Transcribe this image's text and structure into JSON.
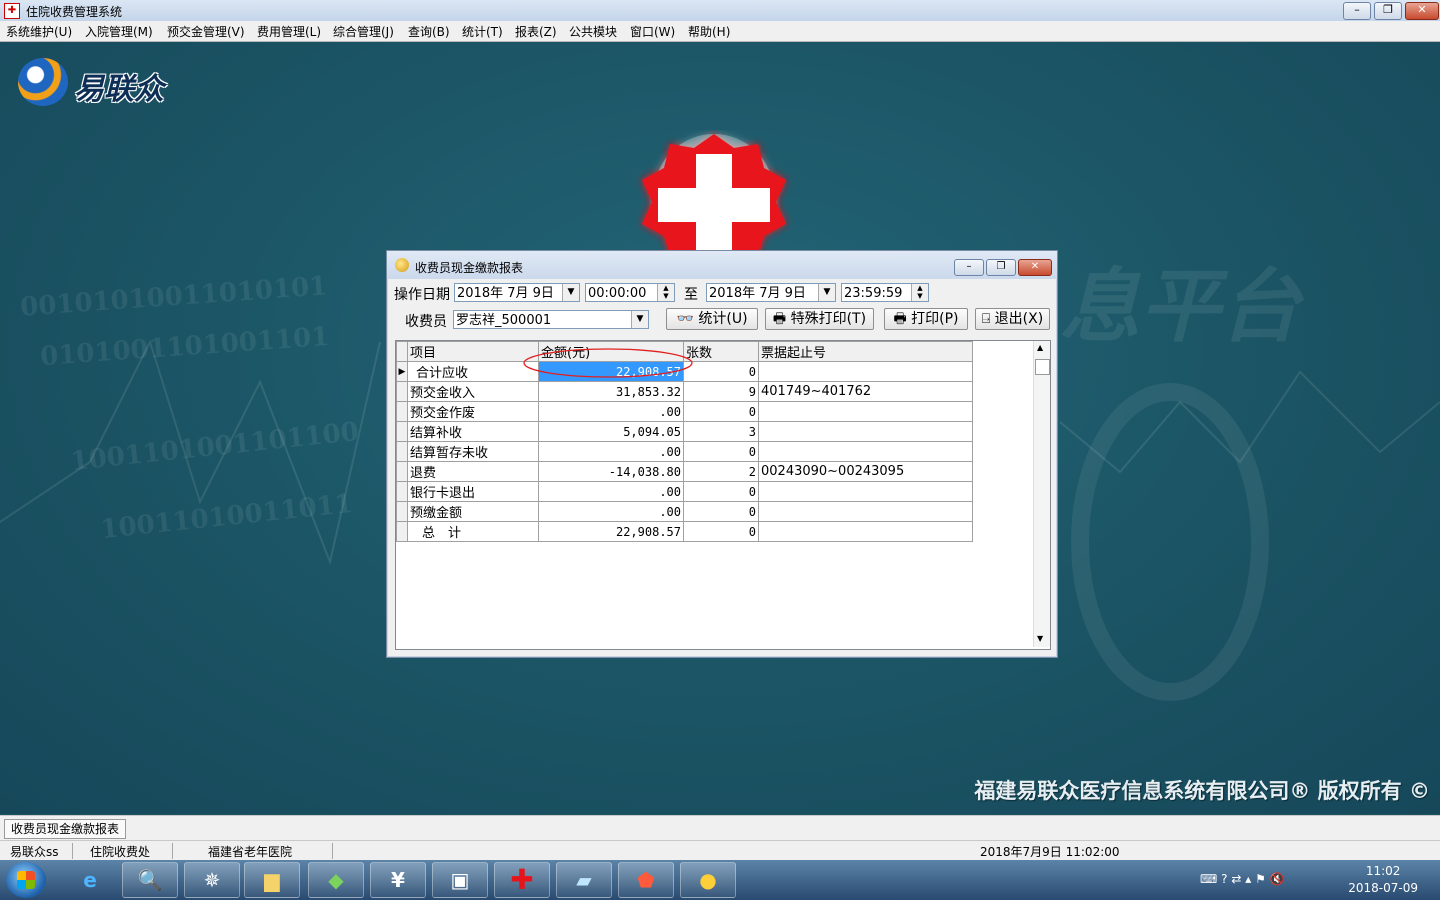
{
  "window": {
    "title": "住院收费管理系统"
  },
  "menu": [
    "系统维护(U)",
    "入院管理(M)",
    "预交金管理(V)",
    "费用管理(L)",
    "综合管理(J)",
    "查询(B)",
    "统计(T)",
    "报表(Z)",
    "公共模块",
    "窗口(W)",
    "帮助(H)"
  ],
  "logo": {
    "text": "易联众"
  },
  "copyright": "福建易联众医疗信息系统有限公司® 版权所有 ©",
  "dialog": {
    "title": "收费员现金缴款报表",
    "op_date_label": "操作日期",
    "start_date": "2018年 7月 9日",
    "start_time": "00:00:00",
    "to_label": "至",
    "end_date": "2018年 7月 9日",
    "end_time": "23:59:59",
    "cashier_label": "收费员",
    "cashier_value": "罗志祥_500001",
    "btn_stat": "统计(U)",
    "btn_special_print": "特殊打印(T)",
    "btn_print": "打印(P)",
    "btn_exit": "退出(X)",
    "grid": {
      "headers": [
        "项目",
        "金额(元)",
        "张数",
        "票据起止号"
      ],
      "rows": [
        {
          "item": "合计应收",
          "amount": "22,908.57",
          "count": "0",
          "range": ""
        },
        {
          "item": "预交金收入",
          "amount": "31,853.32",
          "count": "9",
          "range": "401749~401762"
        },
        {
          "item": "预交金作废",
          "amount": ".00",
          "count": "0",
          "range": ""
        },
        {
          "item": "结算补收",
          "amount": "5,094.05",
          "count": "3",
          "range": ""
        },
        {
          "item": "结算暂存未收",
          "amount": ".00",
          "count": "0",
          "range": ""
        },
        {
          "item": "退费",
          "amount": "-14,038.80",
          "count": "2",
          "range": "00243090~00243095"
        },
        {
          "item": "银行卡退出",
          "amount": ".00",
          "count": "0",
          "range": ""
        },
        {
          "item": "预缴金额",
          "amount": ".00",
          "count": "0",
          "range": ""
        },
        {
          "item": "总　计",
          "amount": "22,908.57",
          "count": "0",
          "range": ""
        }
      ]
    }
  },
  "mdi_tab": "收费员现金缴款报表",
  "status": {
    "user": "易联众ss",
    "dept": "住院收费处",
    "hospital": "福建省老年医院",
    "datetime": "2018年7月9日 11:02:00"
  },
  "clock": {
    "time": "11:02",
    "date": "2018-07-09"
  },
  "bg_text": {
    "watermark": "息平台"
  }
}
